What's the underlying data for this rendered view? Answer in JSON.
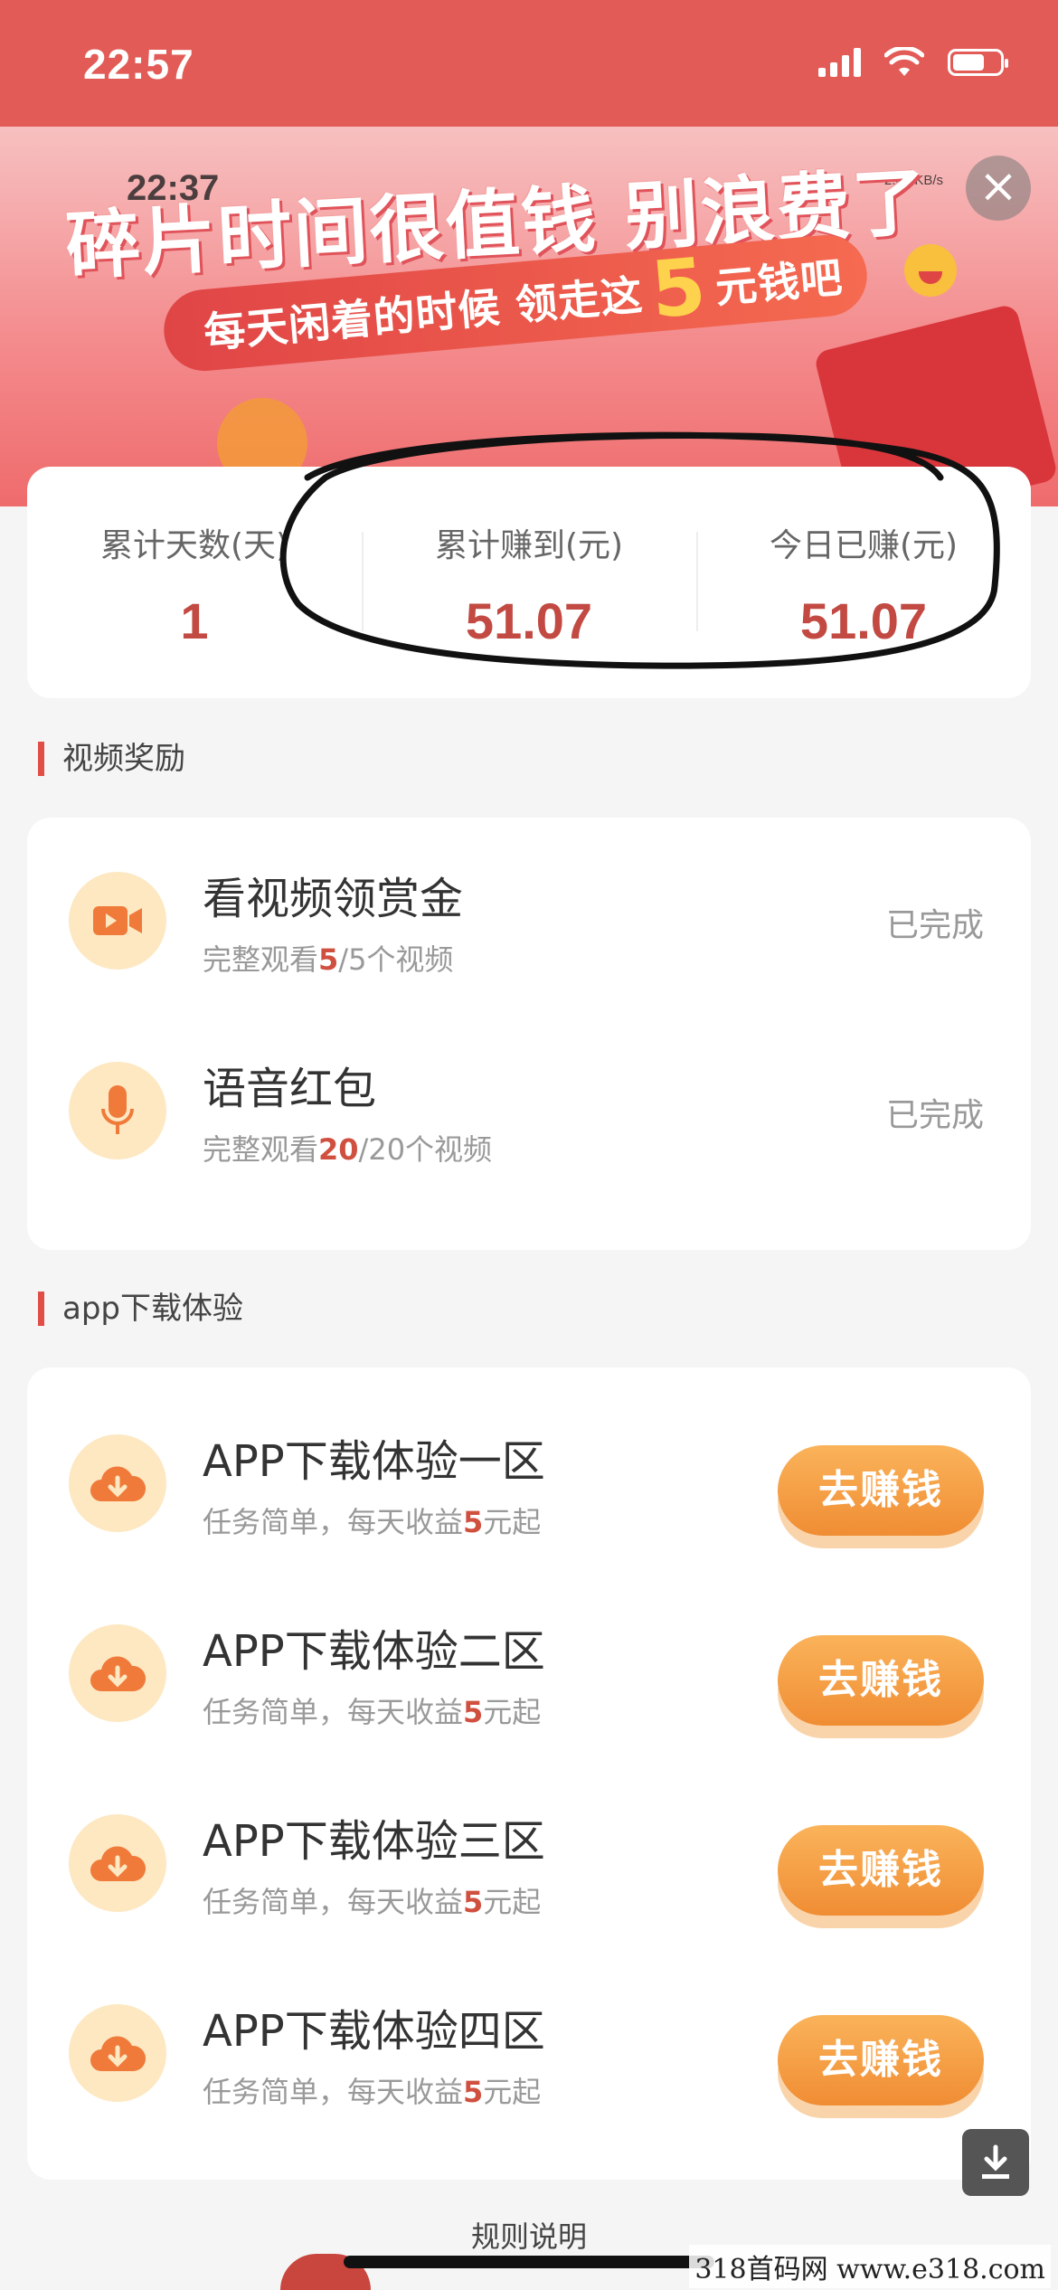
{
  "status_bar": {
    "time": "22:57"
  },
  "banner": {
    "inner_time": "22:37",
    "inner_rate": "2.40 KB/s",
    "title": "碎片时间很值钱 别浪费了",
    "pill_prefix": "每天闲着的时候 领走这",
    "pill_amount": "5",
    "pill_suffix": "元钱吧"
  },
  "stats": [
    {
      "label": "累计天数(天)",
      "value": "1"
    },
    {
      "label": "累计赚到(元)",
      "value": "51.07"
    },
    {
      "label": "今日已赚(元)",
      "value": "51.07"
    }
  ],
  "video_section": {
    "title": "视频奖励",
    "tasks": [
      {
        "title": "看视频领赏金",
        "sub_pre": "完整观看",
        "sub_hl": "5",
        "sub_post": "/5个视频",
        "status": "已完成"
      },
      {
        "title": "语音红包",
        "sub_pre": "完整观看",
        "sub_hl": "20",
        "sub_post": "/20个视频",
        "status": "已完成"
      }
    ]
  },
  "app_section": {
    "title": "app下载体验",
    "tasks": [
      {
        "title": "APP下载体验一区",
        "sub_pre": "任务简单，每天收益",
        "sub_hl": "5",
        "sub_post": "元起",
        "button": "去赚钱"
      },
      {
        "title": "APP下载体验二区",
        "sub_pre": "任务简单，每天收益",
        "sub_hl": "5",
        "sub_post": "元起",
        "button": "去赚钱"
      },
      {
        "title": "APP下载体验三区",
        "sub_pre": "任务简单，每天收益",
        "sub_hl": "5",
        "sub_post": "元起",
        "button": "去赚钱"
      },
      {
        "title": "APP下载体验四区",
        "sub_pre": "任务简单，每天收益",
        "sub_hl": "5",
        "sub_post": "元起",
        "button": "去赚钱"
      }
    ]
  },
  "rules_label": "规则说明",
  "watermark": "318首码网 www.e318.com",
  "icons": {
    "close": "close-icon",
    "video": "video-camera-icon",
    "mic": "microphone-icon",
    "download_cloud": "cloud-download-icon",
    "download": "download-icon"
  },
  "colors": {
    "header": "#e25b56",
    "accent": "#c24a42",
    "button": "#f39a3a"
  }
}
